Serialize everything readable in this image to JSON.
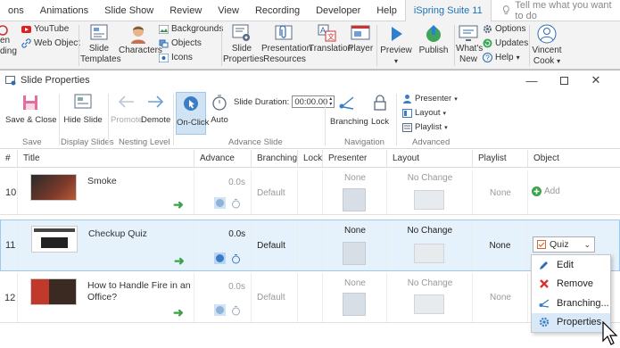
{
  "pp_tabs": [
    "ons",
    "Animations",
    "Slide Show",
    "Review",
    "View",
    "Recording",
    "Developer",
    "Help",
    "iSpring Suite 11"
  ],
  "tell_me": "Tell me what you want to do",
  "pp_ribbon": {
    "youtube": "YouTube",
    "web_object": "Web Object",
    "open_rec_1": "en",
    "open_rec_2": "ding",
    "slide_templates_1": "Slide",
    "slide_templates_2": "Templates",
    "characters": "Characters",
    "backgrounds": "Backgrounds",
    "objects": "Objects",
    "icons": "Icons",
    "slide_properties_1": "Slide",
    "slide_properties_2": "Properties",
    "presentation_resources_1": "Presentation",
    "presentation_resources_2": "Resources",
    "translation": "Translation",
    "player": "Player",
    "preview": "Preview",
    "publish": "Publish",
    "whats_new_1": "What's",
    "whats_new_2": "New",
    "options": "Options",
    "updates": "Updates",
    "help": "Help",
    "vincent_1": "Vincent",
    "vincent_2": "Cook"
  },
  "dialog": {
    "title": "Slide Properties",
    "save_close": "Save & Close",
    "hide_slide": "Hide Slide",
    "promote": "Promote",
    "demote": "Demote",
    "on_click": "On-Click",
    "auto": "Auto",
    "slide_duration_label": "Slide Duration:",
    "slide_duration_value": "00:00.00",
    "branching": "Branching",
    "lock": "Lock",
    "presenter": "Presenter",
    "layout": "Layout",
    "playlist": "Playlist",
    "groups": {
      "save": "Save",
      "display": "Display Slides",
      "nesting": "Nesting Level",
      "advance": "Advance Slide",
      "navigation": "Navigation",
      "advanced": "Advanced"
    }
  },
  "columns": [
    "#",
    "Title",
    "Advance",
    "Branching",
    "Lock",
    "Presenter",
    "Layout",
    "Playlist",
    "Object"
  ],
  "rows": [
    {
      "num": "10",
      "title": "Smoke",
      "title2": "",
      "time": "0.0s",
      "branching": "Default",
      "presenter": "None",
      "layout": "No Change",
      "playlist": "None",
      "object": "Add"
    },
    {
      "num": "11",
      "title": "Checkup Quiz",
      "title2": "",
      "time": "0.0s",
      "branching": "Default",
      "presenter": "None",
      "layout": "No Change",
      "playlist": "None",
      "object": "Quiz"
    },
    {
      "num": "12",
      "title": "How to Handle Fire in an",
      "title2": "Office?",
      "time": "0.0s",
      "branching": "Default",
      "presenter": "None",
      "layout": "No Change",
      "playlist": "None",
      "object": ""
    }
  ],
  "context_menu": [
    "Edit",
    "Remove",
    "Branching...",
    "Properties"
  ],
  "colors": {
    "accent": "#1a73b8",
    "selected_row": "#e5f1fb",
    "green": "#39a24a"
  }
}
